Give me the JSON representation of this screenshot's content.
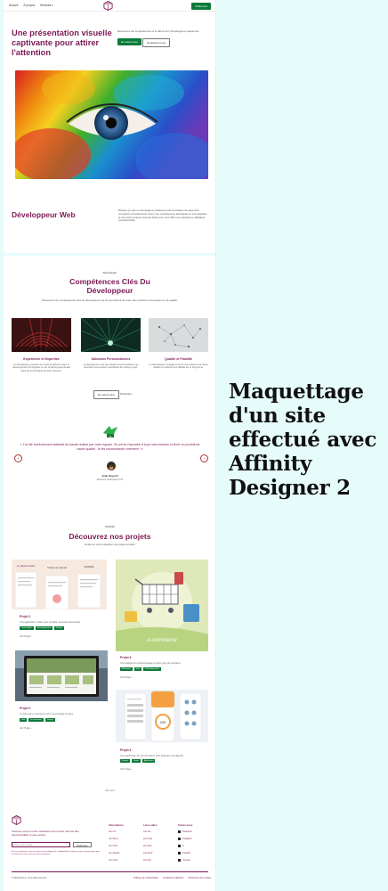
{
  "side_caption": "Maquettage d'un site effectué avec Affinity Designer 2",
  "nav": {
    "items": [
      "Accueil",
      "À propos",
      "Services ▾"
    ],
    "cta": "S'abonner"
  },
  "hero": {
    "title": "Une présentation visuelle captivante pour attirer l'attention",
    "desc": "Découvrez les compétences et le talent d'un Développeur passionné.",
    "btn_primary": "En savoir plus",
    "btn_secondary": "Contactez-nous"
  },
  "dev": {
    "title": "Développeur Web",
    "desc": "Bonjour, je suis un développeur passionné par la création de sites web innovants et fonctionnels. Avec mes compétences techniques et ma créativité, je suis prêt à relever tous les défis pour vous offrir une expérience utilisateur exceptionnelle."
  },
  "skills": {
    "eyebrow": "Développer",
    "title": "Compétences Clés Du Développeur",
    "sub": "Découvrez les compétences clés du développeur qui lui permettent de créer des solutions innovantes et de qualité.",
    "items": [
      {
        "title": "Expérience et Expertise",
        "desc": "Le développeur possède une vaste expérience dans le développement de logiciels et une expertise approfondie dans les technologies les plus récentes."
      },
      {
        "title": "Solutions Personnalisées",
        "desc": "Le développeur crée des solutions personnalisées qui répondent aux besoins spécifiques de chaque projet."
      },
      {
        "title": "Qualité et Fiabilité",
        "desc": "Le développeur s'engage à fournir des solutions de haute qualité et à assurer leur fiabilité sur le long terme."
      }
    ],
    "btn_primary": "En savoir plus",
    "btn_link": "S'inscrire ›"
  },
  "testimonial": {
    "quote": "« J'ai été extrêmement satisfait du travail réalisé par votre équipe. Ils ont su répondre à tous mes besoins et livrer un produit de haute qualité. Je les recommande vivement ! »",
    "name": "Jean Dupont",
    "role": "Directeur, Entreprise XYZ",
    "prev": "‹",
    "next": "›"
  },
  "projects": {
    "eyebrow": "Portfolio",
    "title": "Découvrez nos projets",
    "sub": "Explorez notre sélection de projets réussis",
    "items": [
      {
        "title": "Projet 1",
        "desc": "Une application mobile pour simplifier la gestion des tâches.",
        "tags": [
          "Technologie",
          "Développement",
          "Design"
        ],
        "link": "Voir Projet ›"
      },
      {
        "title": "Projet 2",
        "desc": "Un site web e-commerce pour une boutique en ligne.",
        "tags": [
          "Web",
          "E-commerce",
          "Design"
        ],
        "link": "Voir Projet ›"
      },
      {
        "title": "Projet 3",
        "desc": "Une plateforme d'apprentissage en ligne pour les étudiants.",
        "tags": [
          "Éducation",
          "Web",
          "Développement"
        ],
        "link": "Voir Projet ›"
      },
      {
        "title": "Projet 4",
        "desc": "Une application de suivi de fitness pour atteindre vos objectifs.",
        "tags": [
          "Fitness",
          "Santé",
          "Application"
        ],
        "link": "Voir Projet ›"
      }
    ],
    "view_all": "Voir tout"
  },
  "footer": {
    "text": "Inscrivez-vous à notre newsletter pour rester informé des fonctionnalités et des sorties.",
    "input_placeholder": "Entrez votre email",
    "btn": "S'abonner",
    "small": "En vous abonnant, vous acceptez notre politique de confidentialité et donnez votre consentement pour recevoir des mises à jour de notre entreprise.",
    "cols": [
      {
        "head": "Informations",
        "items": [
          "Lien Un",
          "Lien Deux",
          "Lien Trois",
          "Lien Quatre",
          "Lien Cinq"
        ]
      },
      {
        "head": "Liens utiles",
        "items": [
          "Lien Six",
          "Lien Sept",
          "Lien Huit",
          "Lien Neuf",
          "Lien Dix"
        ]
      },
      {
        "head": "Suivez-nous",
        "items": [
          "Facebook",
          "Instagram",
          "X",
          "LinkedIn",
          "Youtube"
        ]
      }
    ],
    "copy": "© 2024 Relume. Tous droits réservés.",
    "links": [
      "Politique de confidentialité",
      "Conditions d'utilisation",
      "Paramètres des cookies"
    ]
  },
  "colors": {
    "accent": "#7c1a55",
    "green": "#0d7a3a",
    "bg": "#e6fcfb"
  }
}
